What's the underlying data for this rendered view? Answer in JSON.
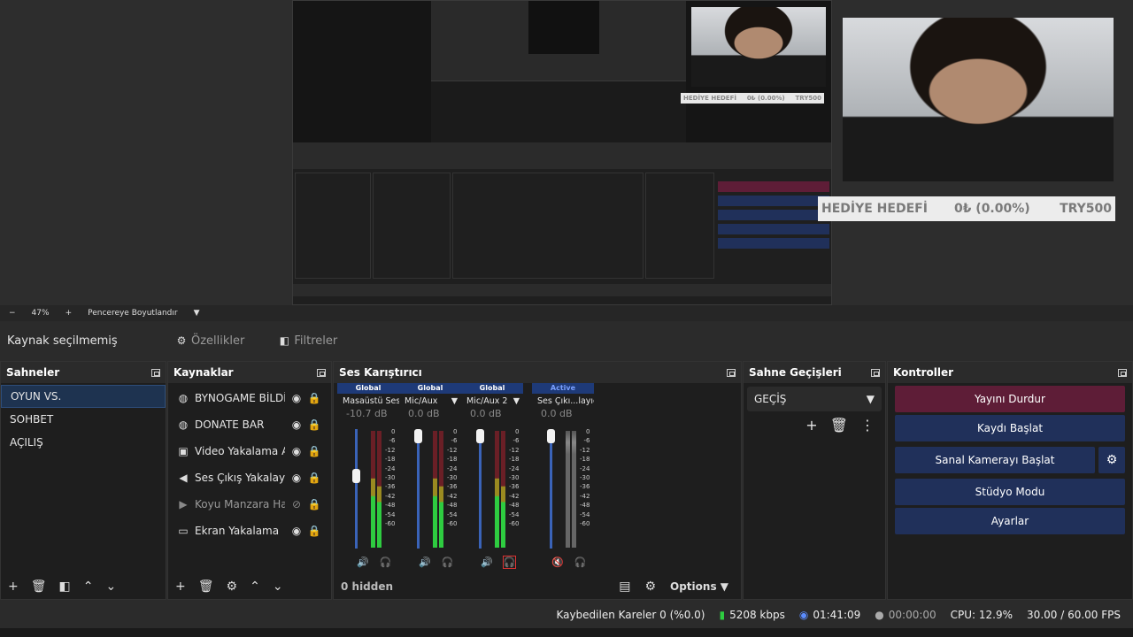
{
  "preview": {
    "nested_goal_left": "HEDİYE HEDEFİ",
    "nested_goal_mid": "0₺ (0.00%)",
    "nested_goal_right": "TRY500",
    "goal_label": "HEDİYE HEDEFİ",
    "goal_progress": "0₺ (0.00%)",
    "goal_target": "TRY500"
  },
  "zoombar": {
    "minus": "−",
    "zoom": "47%",
    "plus": "+",
    "fit_label": "Pencereye Boyutlandır"
  },
  "source_toolbar": {
    "status": "Kaynak seçilmemiş",
    "properties": "Özellikler",
    "filters": "Filtreler"
  },
  "docks": {
    "scenes": "Sahneler",
    "sources": "Kaynaklar",
    "mixer": "Ses Karıştırıcı",
    "transitions": "Sahne Geçişleri",
    "controls": "Kontroller"
  },
  "scenes": [
    "OYUN VS.",
    "SOHBET",
    "AÇILIŞ"
  ],
  "sources": [
    {
      "name": "BYNOGAME BİLDİRİ",
      "icon": "globe-icon"
    },
    {
      "name": "DONATE BAR",
      "icon": "globe-icon"
    },
    {
      "name": "Video Yakalama Aygıtı",
      "icon": "camera-icon"
    },
    {
      "name": "Ses Çıkış Yakalayıcısı",
      "icon": "speaker-icon"
    },
    {
      "name": "Koyu Manzara Hareketli",
      "icon": "play-icon"
    },
    {
      "name": "Ekran Yakalama",
      "icon": "monitor-icon"
    }
  ],
  "mixer": {
    "channels": [
      {
        "head": "Global",
        "name": "Masaüstü Ses",
        "db": "-10.7 dB",
        "level": 0.62
      },
      {
        "head": "Global",
        "name": "Mic/Aux",
        "db": "0.0 dB",
        "level": 1.0
      },
      {
        "head": "Global",
        "name": "Mic/Aux 2",
        "db": "0.0 dB",
        "level": 1.0
      },
      {
        "head": "Active",
        "name": "Ses Çıkı...layıcısı",
        "db": "0.0 dB",
        "level": 1.0
      }
    ],
    "scale": [
      "0",
      "-6",
      "-12",
      "-18",
      "-24",
      "-30",
      "-36",
      "-42",
      "-48",
      "-54",
      "-60"
    ],
    "hidden": "0 hidden",
    "options": "Options"
  },
  "transitions": {
    "selected": "GEÇİŞ"
  },
  "controls": {
    "stop_stream": "Yayını Durdur",
    "start_record": "Kaydı Başlat",
    "virtual_cam": "Sanal Kamerayı Başlat",
    "studio": "Stüdyo Modu",
    "settings": "Ayarlar"
  },
  "status": {
    "dropped": "Kaybedilen Kareler 0 (%0.0)",
    "bitrate": "5208 kbps",
    "live_time": "01:41:09",
    "rec_time": "00:00:00",
    "cpu": "CPU: 12.9%",
    "fps": "30.00 / 60.00 FPS"
  },
  "colors": {
    "accent_blue": "#20305a",
    "stop_red": "#5e1d37",
    "meter_green": "#2ecc40"
  }
}
